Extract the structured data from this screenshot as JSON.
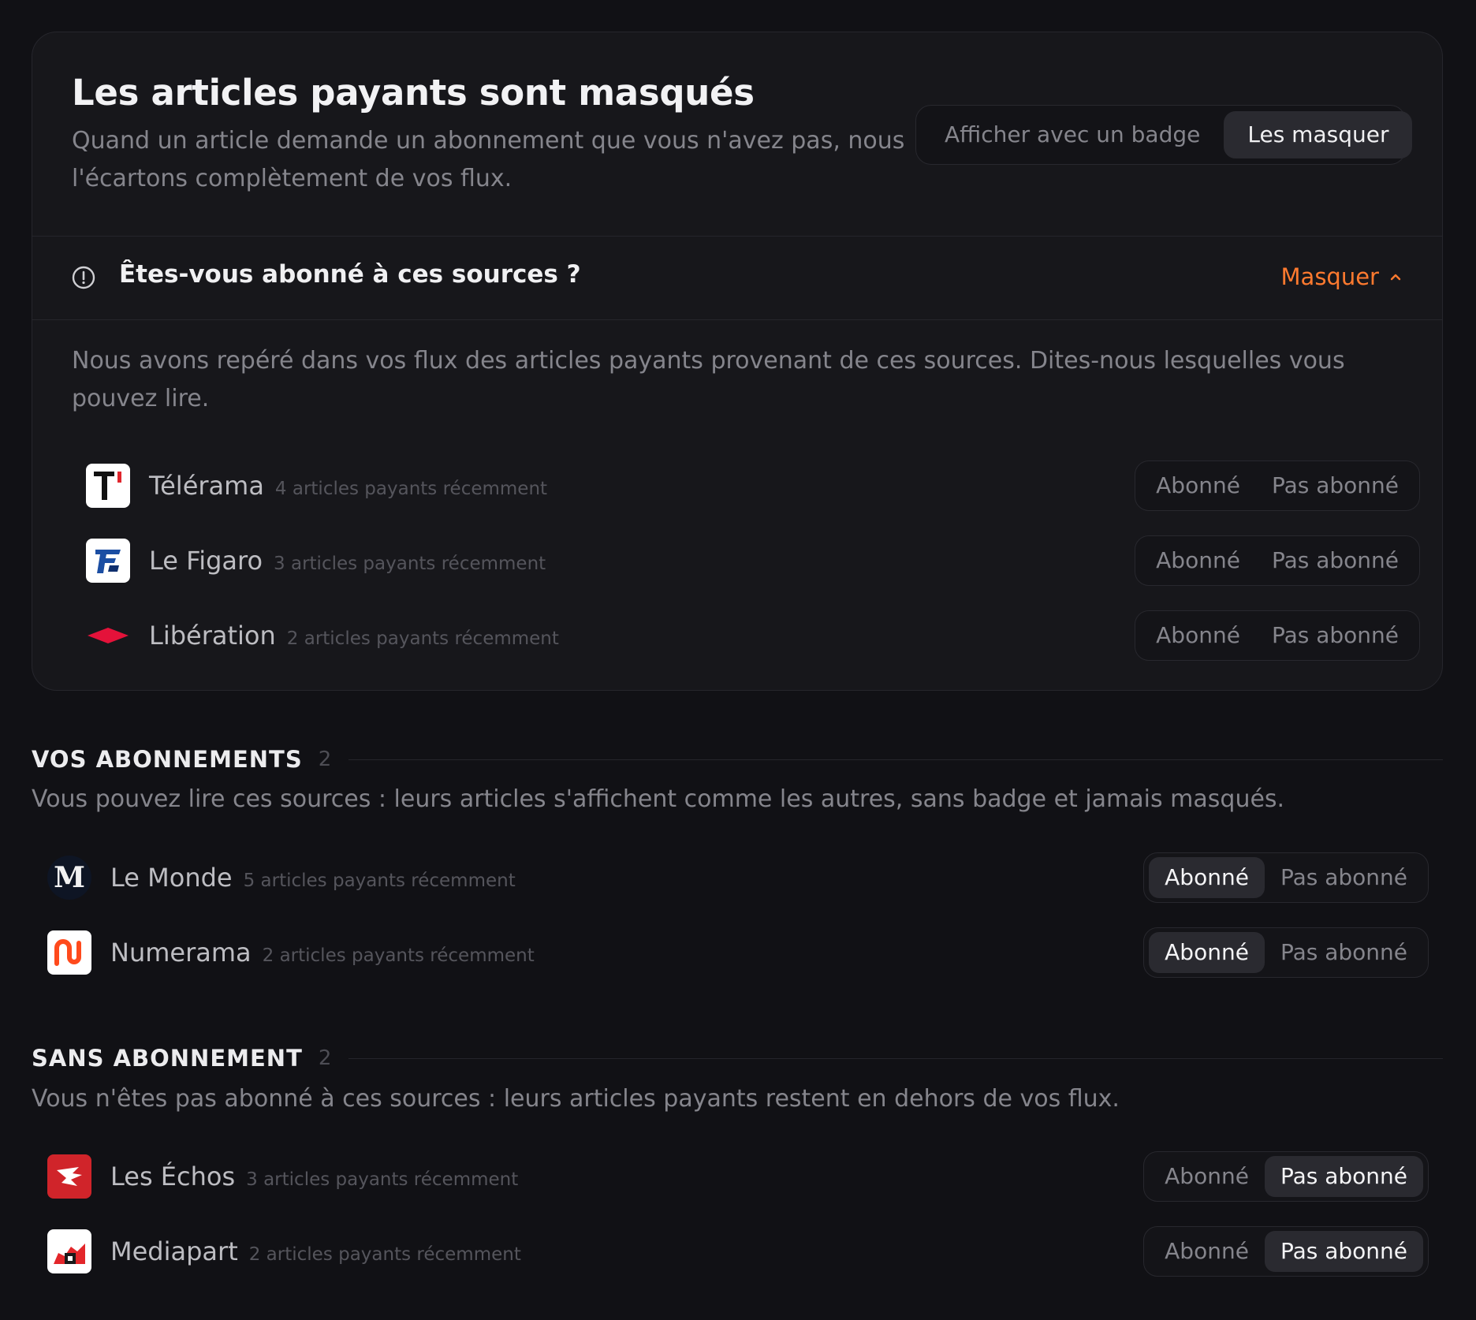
{
  "settings": {
    "title": "Les articles payants sont masqués",
    "description": "Quand un article demande un abonnement que vous n'avez pas, nous l'écartons complètement de vos flux.",
    "mode_options": [
      "Afficher avec un badge",
      "Les masquer"
    ],
    "mode_selected": "Les masquer"
  },
  "ask": {
    "title": "Êtes-vous abonné à ces sources ?",
    "toggle_label": "Masquer",
    "intro": "Nous avons repéré dans vos flux des articles payants provenant de ces sources. Dites-nous lesquelles vous pouvez lire.",
    "sources": [
      {
        "name": "Télérama",
        "count": "4 articles payants récemment",
        "state": "none",
        "icon": "telerama-logo"
      },
      {
        "name": "Le Figaro",
        "count": "3 articles payants récemment",
        "state": "none",
        "icon": "le-figaro-logo"
      },
      {
        "name": "Libération",
        "count": "2 articles payants récemment",
        "state": "none",
        "icon": "liberation-logo"
      }
    ]
  },
  "subscribed": {
    "title": "VOS ABONNEMENTS",
    "count": "2",
    "description": "Vous pouvez lire ces sources : leurs articles s'affichent comme les autres, sans badge et jamais masqués.",
    "sources": [
      {
        "name": "Le Monde",
        "count": "5 articles payants récemment",
        "state": "subscribed",
        "icon": "le-monde-logo"
      },
      {
        "name": "Numerama",
        "count": "2 articles payants récemment",
        "state": "subscribed",
        "icon": "numerama-logo"
      }
    ]
  },
  "unsubscribed": {
    "title": "SANS ABONNEMENT",
    "count": "2",
    "description": "Vous n'êtes pas abonné à ces sources : leurs articles payants restent en dehors de vos flux.",
    "sources": [
      {
        "name": "Les Échos",
        "count": "3 articles payants récemment",
        "state": "not_subscribed",
        "icon": "les-echos-logo"
      },
      {
        "name": "Mediapart",
        "count": "2 articles payants récemment",
        "state": "not_subscribed",
        "icon": "mediapart-logo"
      }
    ]
  },
  "labels": {
    "subscribed": "Abonné",
    "not_subscribed": "Pas abonné"
  },
  "colors": {
    "accent": "#ff7a2f",
    "background": "#111115",
    "card": "#17171b",
    "selected": "#2a2a30"
  }
}
